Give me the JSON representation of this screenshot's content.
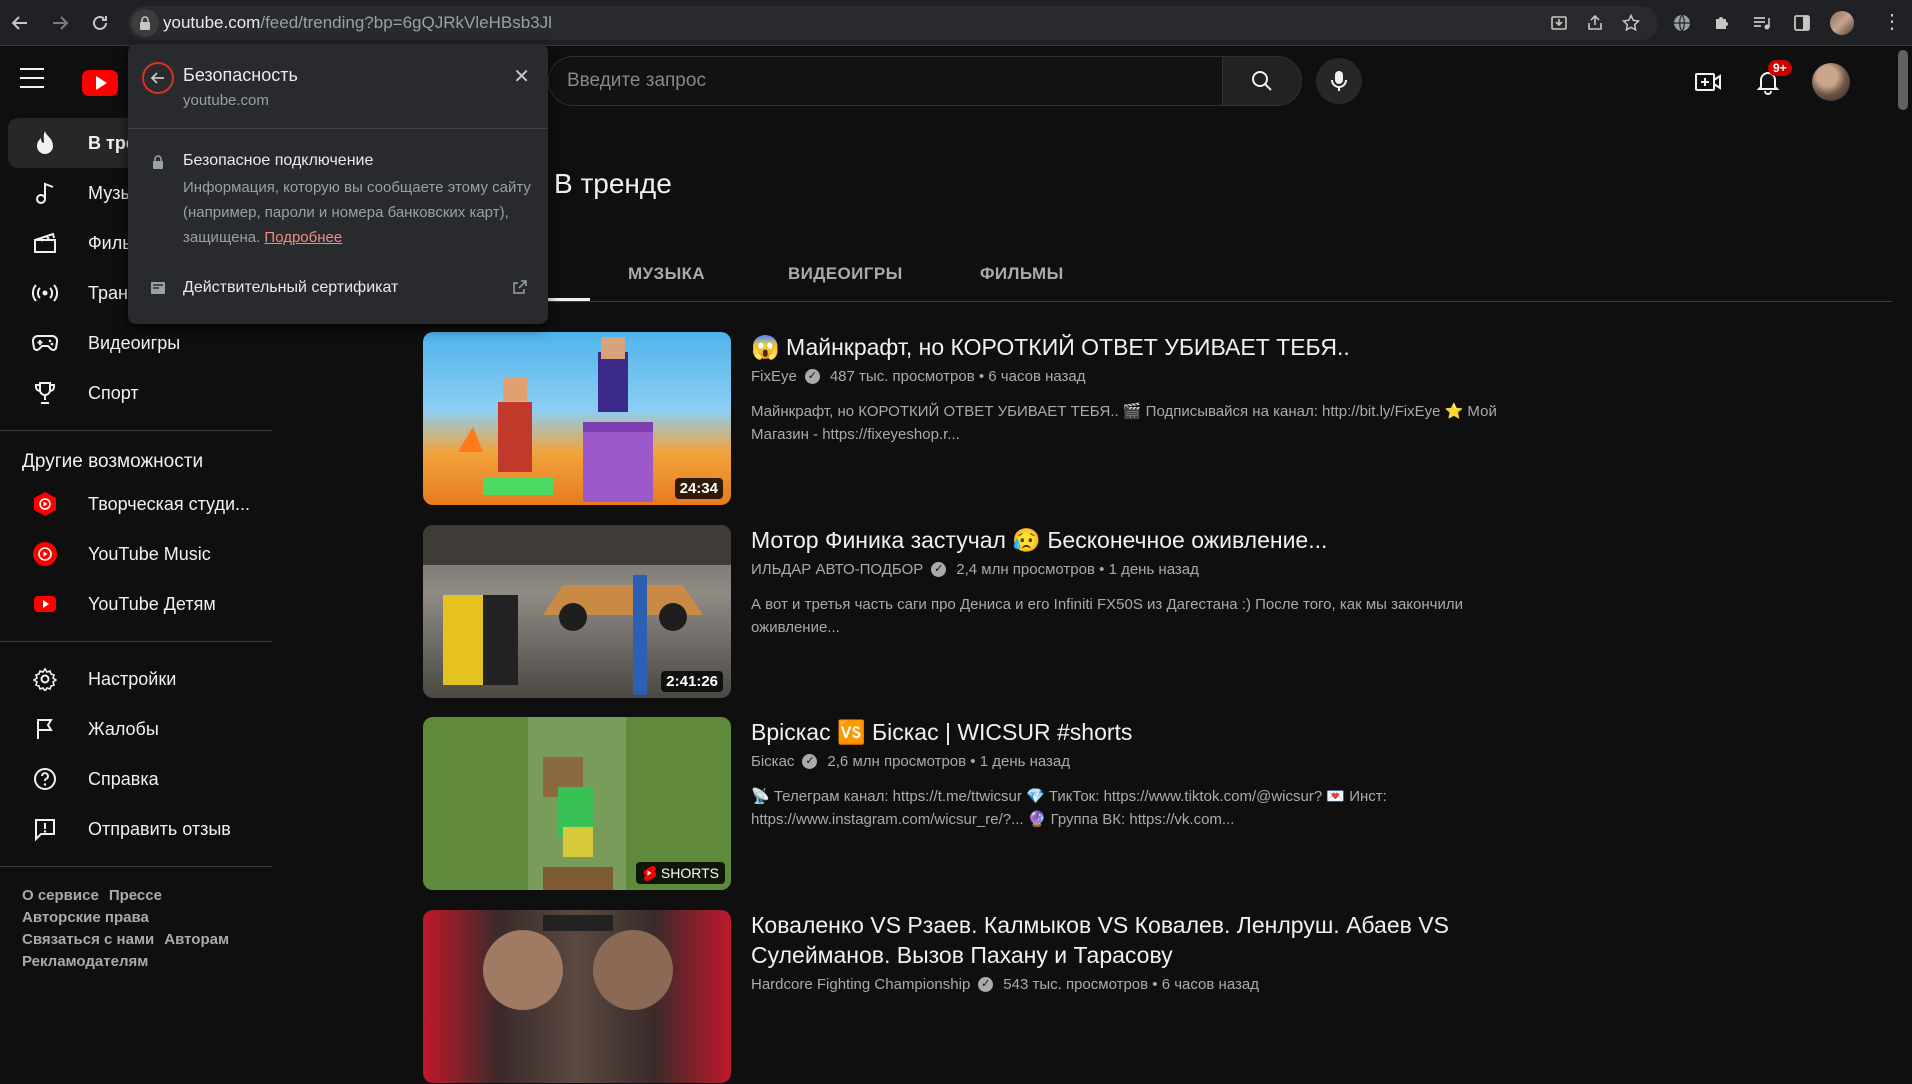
{
  "browser": {
    "url_host": "youtube.com",
    "url_path": "/feed/trending?bp=6gQJRkVleHBsb3Jl"
  },
  "header": {
    "search_placeholder": "Введите запрос",
    "notification_count": "9+"
  },
  "sidebar": {
    "items": [
      {
        "label": "В тренде",
        "icon": "fire-icon"
      },
      {
        "label": "Музыка",
        "icon": "music-note-icon"
      },
      {
        "label": "Фильмы",
        "icon": "clapperboard-icon"
      },
      {
        "label": "Трансляции",
        "icon": "broadcast-icon"
      },
      {
        "label": "Видеоигры",
        "icon": "gamepad-icon"
      },
      {
        "label": "Спорт",
        "icon": "trophy-icon"
      }
    ],
    "more_heading": "Другие возможности",
    "more_items": [
      {
        "label": "Творческая студи...",
        "icon": "youtube-studio-icon"
      },
      {
        "label": "YouTube Music",
        "icon": "youtube-music-icon"
      },
      {
        "label": "YouTube Детям",
        "icon": "youtube-kids-icon"
      }
    ],
    "settings_items": [
      {
        "label": "Настройки",
        "icon": "gear-icon"
      },
      {
        "label": "Жалобы",
        "icon": "flag-icon"
      },
      {
        "label": "Справка",
        "icon": "help-icon"
      },
      {
        "label": "Отправить отзыв",
        "icon": "feedback-icon"
      }
    ],
    "footer": {
      "about": "О сервисе",
      "press": "Прессе",
      "copyright": "Авторские права",
      "contact": "Связаться с нами",
      "creators": "Авторам",
      "advertise": "Рекламодателям"
    }
  },
  "main": {
    "title": "В тренде",
    "tabs": [
      "МУЗЫКА",
      "ВИДЕОИГРЫ",
      "ФИЛЬМЫ"
    ],
    "videos": [
      {
        "title": "😱 Майнкрафт, но КОРОТКИЙ ОТВЕТ УБИВАЕТ ТЕБЯ..",
        "channel": "FixEye",
        "views": "487 тыс. просмотров",
        "age": "6 часов назад",
        "description": "Майнкрафт, но КОРОТКИЙ ОТВЕТ УБИВАЕТ ТЕБЯ.. 🎬 Подписывайся на канал: http://bit.ly/FixEye ⭐ Мой Магазин - https://fixeyeshop.r...",
        "duration": "24:34"
      },
      {
        "title": "Мотор Финика застучал 😥 Бесконечное оживление...",
        "channel": "ИЛЬДАР АВТО-ПОДБОР",
        "views": "2,4 млн просмотров",
        "age": "1 день назад",
        "description": "А вот и третья часть саги про Дениса и его Infiniti FX50S из Дагестана :) После того, как мы закончили оживление...",
        "duration": "2:41:26"
      },
      {
        "title": "Вріскас 🆚 Біскас | WICSUR #shorts",
        "channel": "Біскас",
        "views": "2,6 млн просмотров",
        "age": "1 день назад",
        "description": "📡 Телеграм канал: https://t.me/ttwicsur 💎 ТикТок: https://www.tiktok.com/@wicsur? 💌 Инст: https://www.instagram.com/wicsur_re/?... 🔮 Группа ВК: https://vk.com...",
        "badge": "SHORTS"
      },
      {
        "title": "Коваленко VS Рзаев. Калмыков VS Ковалев. Ленлруш. Абаев VS Сулейманов. Вызов Пахану и Тарасову",
        "channel": "Hardcore Fighting Championship",
        "views": "543 тыс. просмотров",
        "age": "6 часов назад"
      }
    ]
  },
  "security_popup": {
    "title": "Безопасность",
    "domain": "youtube.com",
    "connection_title": "Безопасное подключение",
    "connection_desc": "Информация, которую вы сообщаете этому сайту (например, пароли и номера банковских карт), защищена.",
    "more_link": "Подробнее",
    "certificate": "Действительный сертификат"
  }
}
